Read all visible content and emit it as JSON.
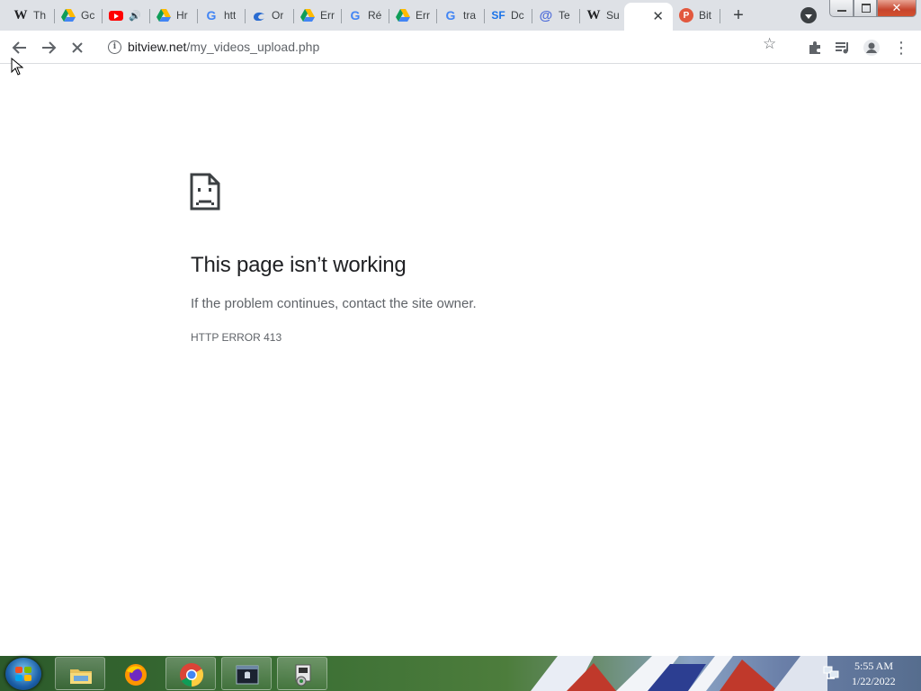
{
  "browser": {
    "tabs": [
      {
        "icon": "wikipedia-icon",
        "favicon_text": "W",
        "label": "Th"
      },
      {
        "icon": "google-drive-icon",
        "favicon_text": "",
        "label": "Gc"
      },
      {
        "icon": "youtube-icon",
        "favicon_text": "",
        "label": "",
        "audio": "🔊"
      },
      {
        "icon": "google-drive-icon",
        "favicon_text": "",
        "label": "Hr"
      },
      {
        "icon": "google-icon",
        "favicon_text": "G",
        "label": "htt"
      },
      {
        "icon": "loop-icon",
        "favicon_text": "",
        "label": "Or"
      },
      {
        "icon": "google-drive-icon",
        "favicon_text": "",
        "label": "Err"
      },
      {
        "icon": "google-icon",
        "favicon_text": "G",
        "label": "Ré"
      },
      {
        "icon": "google-drive-icon",
        "favicon_text": "",
        "label": "Err"
      },
      {
        "icon": "google-icon",
        "favicon_text": "G",
        "label": "tra"
      },
      {
        "icon": "sf-icon",
        "favicon_text": "SF",
        "label": "Dc"
      },
      {
        "icon": "at-icon",
        "favicon_text": "@",
        "label": "Te"
      },
      {
        "icon": "wikipedia-icon",
        "favicon_text": "W",
        "label": "Su"
      },
      {
        "icon": "",
        "favicon_text": "",
        "label": "",
        "active": true,
        "close": "✕"
      },
      {
        "icon": "p-icon",
        "favicon_text": "P",
        "label": "Bit"
      }
    ],
    "new_tab": "+",
    "window_close": "✕"
  },
  "toolbar": {
    "url_host": "bitview.net",
    "url_path": "/my_videos_upload.php",
    "info_glyph": "i",
    "back_glyph": "←",
    "forward_glyph": "→",
    "stop_glyph": "✕",
    "star_glyph": "☆",
    "menu_glyph": "⋮"
  },
  "page": {
    "title": "This page isn’t working",
    "message": "If the problem continues, contact the site owner.",
    "error_code": "HTTP ERROR 413"
  },
  "taskbar": {
    "time": "5:55 AM",
    "date": "1/22/2022"
  }
}
